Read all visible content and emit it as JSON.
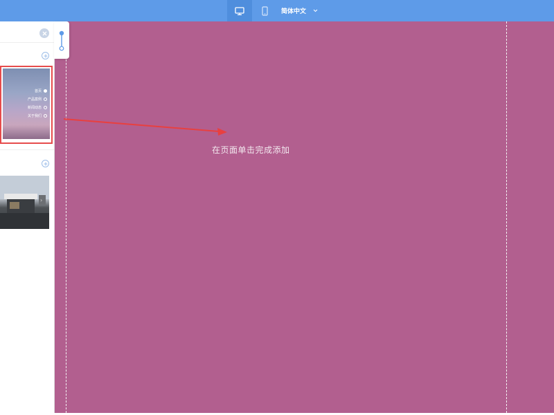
{
  "topbar": {
    "devices": [
      {
        "name": "desktop-icon",
        "active": true
      },
      {
        "name": "mobile-icon",
        "active": false
      }
    ],
    "language_label": "简体中文"
  },
  "panel": {
    "thumbnail_nav_items": [
      "首页",
      "产品案例",
      "新闻动态",
      "关于我们"
    ]
  },
  "canvas": {
    "hint_text": "在页面单击完成添加"
  },
  "colors": {
    "topbar": "#5e9be8",
    "canvas": "#b25f8f",
    "selection_border": "#e64b4b",
    "arrow": "#e84040"
  }
}
